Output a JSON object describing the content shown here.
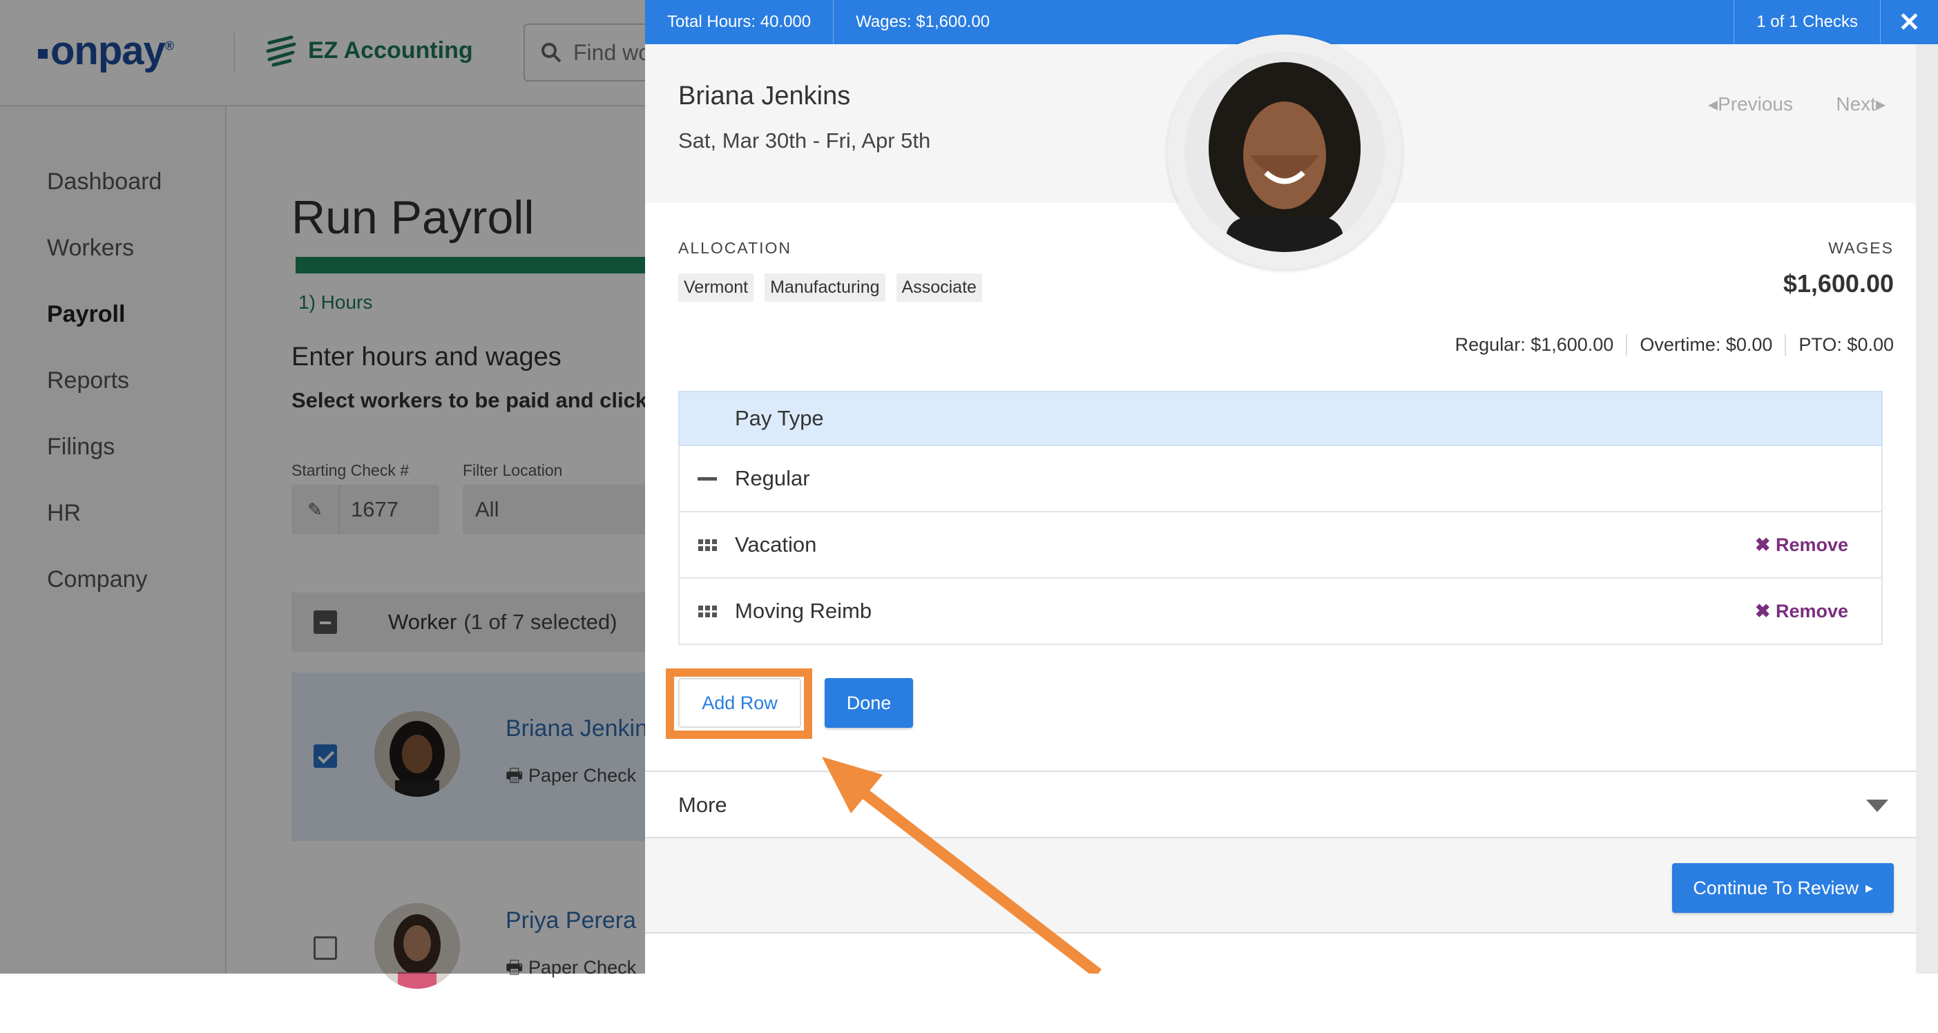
{
  "background": {
    "logo_text": "onpay",
    "product_name": "EZ Accounting",
    "search_placeholder": "Find wo",
    "nav": [
      "Dashboard",
      "Workers",
      "Payroll",
      "Reports",
      "Filings",
      "HR",
      "Company"
    ],
    "page_title": "Run Payroll",
    "step_label": "1) Hours",
    "section_title": "Enter hours and wages",
    "section_subtitle": "Select workers to be paid and click t",
    "starting_check_label": "Starting Check #",
    "starting_check_value": "1677",
    "filter_location_label": "Filter Location",
    "filter_location_value": "All",
    "worker_header": "Worker",
    "worker_selected": "(1 of 7 selected)",
    "workers": [
      {
        "name": "Briana Jenkins",
        "method": "Paper Check",
        "checked": true
      },
      {
        "name": "Priya Perera",
        "method": "Paper Check",
        "checked": false
      }
    ]
  },
  "drawer": {
    "top_bar": {
      "total_hours": "Total Hours: 40.000",
      "wages": "Wages: $1,600.00",
      "checks": "1 of 1 Checks"
    },
    "employee_name": "Briana Jenkins",
    "date_range": "Sat, Mar 30th - Fri, Apr 5th",
    "previous_label": "Previous",
    "next_label": "Next",
    "allocation_label": "ALLOCATION",
    "allocation_chips": [
      "Vermont",
      "Manufacturing",
      "Associate"
    ],
    "wages_label": "WAGES",
    "wages_value": "$1,600.00",
    "breakdown": {
      "regular": "Regular: $1,600.00",
      "overtime": "Overtime: $0.00",
      "pto": "PTO: $0.00"
    },
    "pay_table": {
      "header": "Pay Type",
      "rows": [
        {
          "label": "Regular",
          "icon": "minus-icon",
          "removable": false
        },
        {
          "label": "Vacation",
          "icon": "drag-handle-icon",
          "removable": true
        },
        {
          "label": "Moving Reimb",
          "icon": "drag-handle-icon",
          "removable": true
        }
      ],
      "remove_label": "Remove"
    },
    "add_row_label": "Add Row",
    "done_label": "Done",
    "more_label": "More",
    "continue_label": "Continue To Review"
  },
  "annotation": {
    "highlight_color": "#f08c3c",
    "arrow_color": "#f08c3c"
  }
}
